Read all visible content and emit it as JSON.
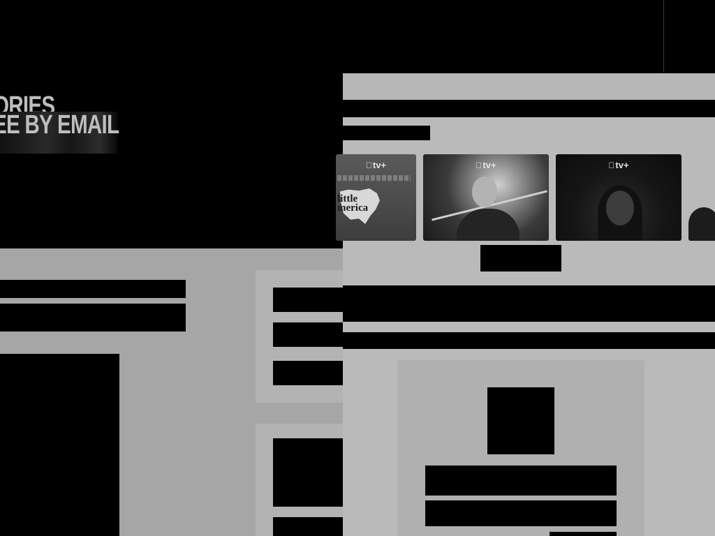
{
  "background_page": {
    "hero": {
      "headline_line1": "ORIES",
      "headline_line2": "EE BY EMAIL"
    }
  },
  "modal": {
    "posters": [
      {
        "badge": "tv+",
        "title": "little\nmerica",
        "icon": "apple-logo-icon"
      },
      {
        "badge": "tv+",
        "icon": "apple-logo-icon"
      },
      {
        "badge": "tv+",
        "icon": "apple-logo-icon"
      },
      {
        "badge": "",
        "icon": ""
      }
    ]
  },
  "colors": {
    "background": "#a6a6a6",
    "hero": "#000000",
    "modal": "#bababa",
    "card": "#b0b0b0",
    "redaction": "#000000"
  }
}
